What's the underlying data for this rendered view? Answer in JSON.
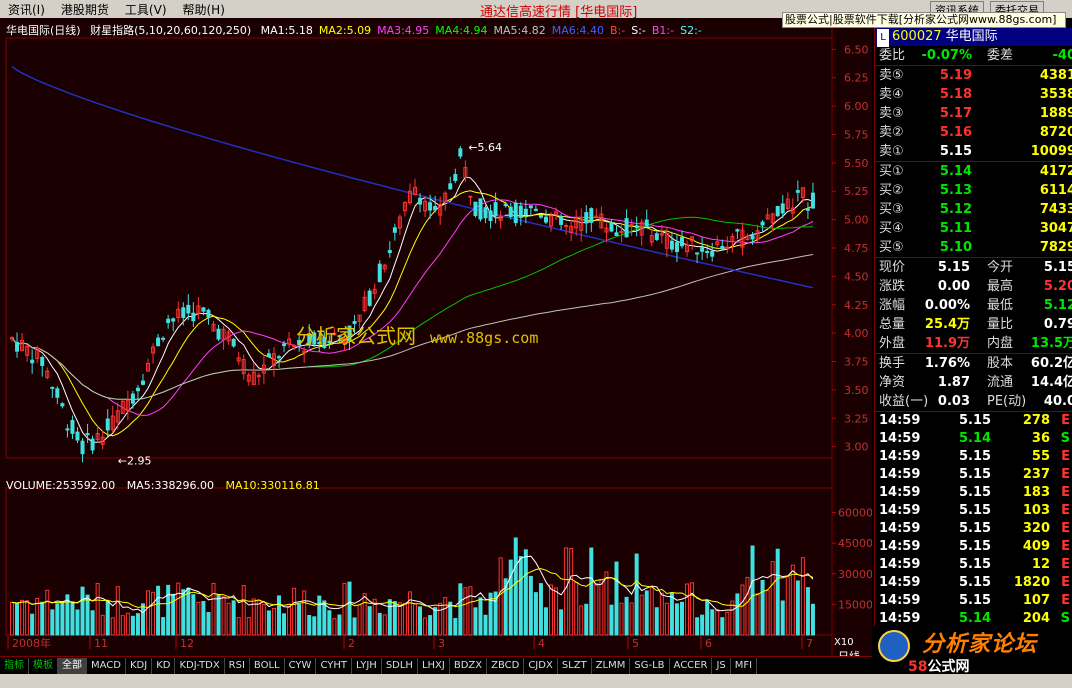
{
  "menu": {
    "items": [
      "资讯(I)",
      "港股期货",
      "工具(V)",
      "帮助(H)"
    ],
    "center_title": "通达信高速行情",
    "center_sub": "[华电国际]",
    "btn_info": "资讯系统",
    "btn_trade": "委托交易",
    "promo": "股票公式|股票软件下载[分析家公式网www.88gs.com]"
  },
  "chart": {
    "stock": "华电国际(日线)",
    "indicator": "财星指路(5,10,20,60,120,250)",
    "ma_values": [
      {
        "label": "MA1:5.18",
        "color": "#ffffff"
      },
      {
        "label": "MA2:5.09",
        "color": "#ffff00"
      },
      {
        "label": "MA3:4.95",
        "color": "#ff40ff"
      },
      {
        "label": "MA4:4.94",
        "color": "#00ff00"
      },
      {
        "label": "MA5:4.82",
        "color": "#c0c0c0"
      },
      {
        "label": "MA6:4.40",
        "color": "#4060ff"
      },
      {
        "label": "B:-",
        "color": "#ff4040"
      },
      {
        "label": "S:-",
        "color": "#ffffff"
      },
      {
        "label": "B1:-",
        "color": "#ff40ff"
      },
      {
        "label": "S2:-",
        "color": "#40ffff"
      }
    ],
    "price_ticks": [
      "6.50",
      "6.25",
      "6.00",
      "5.75",
      "5.50",
      "5.25",
      "5.00",
      "4.75",
      "4.50",
      "4.25",
      "4.00",
      "3.75",
      "3.50",
      "3.25",
      "3.00"
    ],
    "high_label": "5.64",
    "low_label": "2.95",
    "volume_label": "VOLUME:253592.00",
    "vol_ma5": "MA5:338296.00",
    "vol_ma10": "MA10:330116.81",
    "vol_ticks": [
      "60000",
      "45000",
      "30000",
      "15000"
    ],
    "vol_unit": "X10",
    "period": "日线",
    "x_labels": [
      "2008年",
      "11",
      "12",
      "2",
      "3",
      "4",
      "5",
      "6",
      "7"
    ],
    "watermark": "分析家公式网",
    "watermark_url": "www.88gs.com"
  },
  "chart_data": {
    "type": "candlestick",
    "title": "华电国际(日线)",
    "y_range": [
      2.95,
      6.55
    ],
    "price_high": 5.64,
    "price_low": 2.95,
    "last_close": 5.15,
    "volume_axis": [
      0,
      60000
    ]
  },
  "tabs": [
    "指标",
    "模板",
    "全部",
    "MACD",
    "KDJ",
    "KD",
    "KDJ-TDX",
    "RSI",
    "BOLL",
    "CYW",
    "CYHT",
    "LYJH",
    "SDLH",
    "LHXJ",
    "BDZX",
    "ZBCD",
    "CJDX",
    "SLZT",
    "ZLMM",
    "SG-LB",
    "ACCER",
    "JS",
    "MFI"
  ],
  "quote": {
    "tag": "L",
    "code": "600027",
    "name": "华电国际",
    "weibi": {
      "label": "委比",
      "value": "-0.07%",
      "label2": "委差",
      "value2": "-40"
    },
    "asks": [
      {
        "label": "卖⑤",
        "price": "5.19",
        "vol": "4381"
      },
      {
        "label": "卖④",
        "price": "5.18",
        "vol": "3538"
      },
      {
        "label": "卖③",
        "price": "5.17",
        "vol": "1889"
      },
      {
        "label": "卖②",
        "price": "5.16",
        "vol": "8720"
      },
      {
        "label": "卖①",
        "price": "5.15",
        "vol": "10099"
      }
    ],
    "bids": [
      {
        "label": "买①",
        "price": "5.14",
        "vol": "4172"
      },
      {
        "label": "买②",
        "price": "5.13",
        "vol": "6114"
      },
      {
        "label": "买③",
        "price": "5.12",
        "vol": "7433"
      },
      {
        "label": "买④",
        "price": "5.11",
        "vol": "3047"
      },
      {
        "label": "买⑤",
        "price": "5.10",
        "vol": "7829"
      }
    ],
    "stats": [
      {
        "l1": "现价",
        "v1": "5.15",
        "c1": "white",
        "l2": "今开",
        "v2": "5.15",
        "c2": "white"
      },
      {
        "l1": "涨跌",
        "v1": "0.00",
        "c1": "white",
        "l2": "最高",
        "v2": "5.20",
        "c2": "red"
      },
      {
        "l1": "涨幅",
        "v1": "0.00%",
        "c1": "white",
        "l2": "最低",
        "v2": "5.12",
        "c2": "green"
      },
      {
        "l1": "总量",
        "v1": "25.4万",
        "c1": "yellow",
        "l2": "量比",
        "v2": "0.79",
        "c2": "white"
      },
      {
        "l1": "外盘",
        "v1": "11.9万",
        "c1": "red",
        "l2": "内盘",
        "v2": "13.5万",
        "c2": "green"
      }
    ],
    "stats2": [
      {
        "l1": "换手",
        "v1": "1.76%",
        "l2": "股本",
        "v2": "60.2亿"
      },
      {
        "l1": "净资",
        "v1": "1.87",
        "l2": "流通",
        "v2": "14.4亿"
      },
      {
        "l1": "收益(一)",
        "v1": "0.03",
        "l2": "PE(动)",
        "v2": "40.0"
      }
    ],
    "ticks": [
      {
        "t": "14:59",
        "p": "5.15",
        "pc": "white",
        "v": "278",
        "s": "E",
        "sc": "red"
      },
      {
        "t": "14:59",
        "p": "5.14",
        "pc": "green",
        "v": "36",
        "s": "S",
        "sc": "green"
      },
      {
        "t": "14:59",
        "p": "5.15",
        "pc": "white",
        "v": "55",
        "s": "E",
        "sc": "red"
      },
      {
        "t": "14:59",
        "p": "5.15",
        "pc": "white",
        "v": "237",
        "s": "E",
        "sc": "red"
      },
      {
        "t": "14:59",
        "p": "5.15",
        "pc": "white",
        "v": "183",
        "s": "E",
        "sc": "red"
      },
      {
        "t": "14:59",
        "p": "5.15",
        "pc": "white",
        "v": "103",
        "s": "E",
        "sc": "red"
      },
      {
        "t": "14:59",
        "p": "5.15",
        "pc": "white",
        "v": "320",
        "s": "E",
        "sc": "red"
      },
      {
        "t": "14:59",
        "p": "5.15",
        "pc": "white",
        "v": "409",
        "s": "E",
        "sc": "red"
      },
      {
        "t": "14:59",
        "p": "5.15",
        "pc": "white",
        "v": "12",
        "s": "E",
        "sc": "red"
      },
      {
        "t": "14:59",
        "p": "5.15",
        "pc": "white",
        "v": "1820",
        "s": "E",
        "sc": "red"
      },
      {
        "t": "14:59",
        "p": "5.15",
        "pc": "white",
        "v": "107",
        "s": "E",
        "sc": "red"
      },
      {
        "t": "14:59",
        "p": "5.14",
        "pc": "green",
        "v": "204",
        "s": "S",
        "sc": "green"
      }
    ],
    "logo_big": "分析家论坛",
    "logo_num": "58",
    "logo_rest": "公式网"
  }
}
